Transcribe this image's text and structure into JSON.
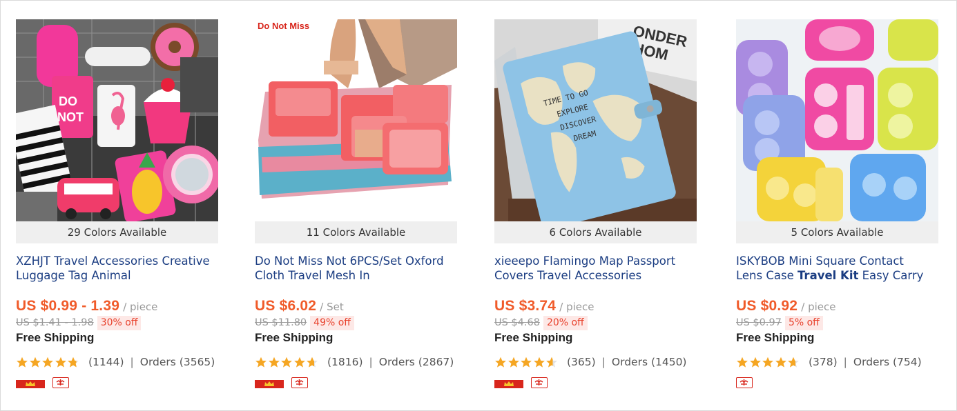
{
  "accent_color": "#f05b2a",
  "link_color": "#1b3d82",
  "star_color": "#f5a623",
  "products": [
    {
      "colors_available": "29 Colors Available",
      "title_line1": "XZHJT Travel Accessories Creative",
      "title_line2": "Luggage Tag Animal",
      "title_line2_bold": "",
      "title_line2_after": "",
      "price": "US $0.99 - 1.39",
      "unit": "/ piece",
      "original_price": "US $1.41 - 1.98",
      "discount": "30% off",
      "shipping": "Free Shipping",
      "rating": 4.8,
      "reviews": "(1144)",
      "separator": "|",
      "orders": "Orders (3565)",
      "has_crown_badge": true,
      "image_overlay_text": "",
      "image_icon": "luggage-tags-image"
    },
    {
      "colors_available": "11 Colors Available",
      "title_line1": "Do Not Miss Not 6PCS/Set Oxford",
      "title_line2": "Cloth Travel Mesh In",
      "title_line2_bold": "",
      "title_line2_after": "",
      "price": "US $6.02",
      "unit": "/ Set",
      "original_price": "US $11.80",
      "discount": "49% off",
      "shipping": "Free Shipping",
      "rating": 4.7,
      "reviews": "(1816)",
      "separator": "|",
      "orders": "Orders (2867)",
      "has_crown_badge": true,
      "image_overlay_text": "Do Not Miss",
      "image_icon": "packing-cubes-image"
    },
    {
      "colors_available": "6 Colors Available",
      "title_line1": "xieeepo Flamingo Map Passport",
      "title_line2": "Covers Travel Accessories",
      "title_line2_bold": "",
      "title_line2_after": "",
      "price": "US $3.74",
      "unit": "/ piece",
      "original_price": "US $4.68",
      "discount": "20% off",
      "shipping": "Free Shipping",
      "rating": 4.6,
      "reviews": "(365)",
      "separator": "|",
      "orders": "Orders (1450)",
      "has_crown_badge": true,
      "image_overlay_text": "",
      "image_icon": "passport-cover-image"
    },
    {
      "colors_available": "5 Colors Available",
      "title_line1": "ISKYBOB Mini Square Contact",
      "title_line2": "Lens Case ",
      "title_line2_bold": "Travel Kit",
      "title_line2_after": " Easy Carry",
      "price": "US $0.92",
      "unit": "/ piece",
      "original_price": "US $0.97",
      "discount": "5% off",
      "shipping": "Free Shipping",
      "rating": 4.7,
      "reviews": "(378)",
      "separator": "|",
      "orders": "Orders (754)",
      "has_crown_badge": false,
      "image_overlay_text": "",
      "image_icon": "contact-lens-case-image"
    }
  ]
}
